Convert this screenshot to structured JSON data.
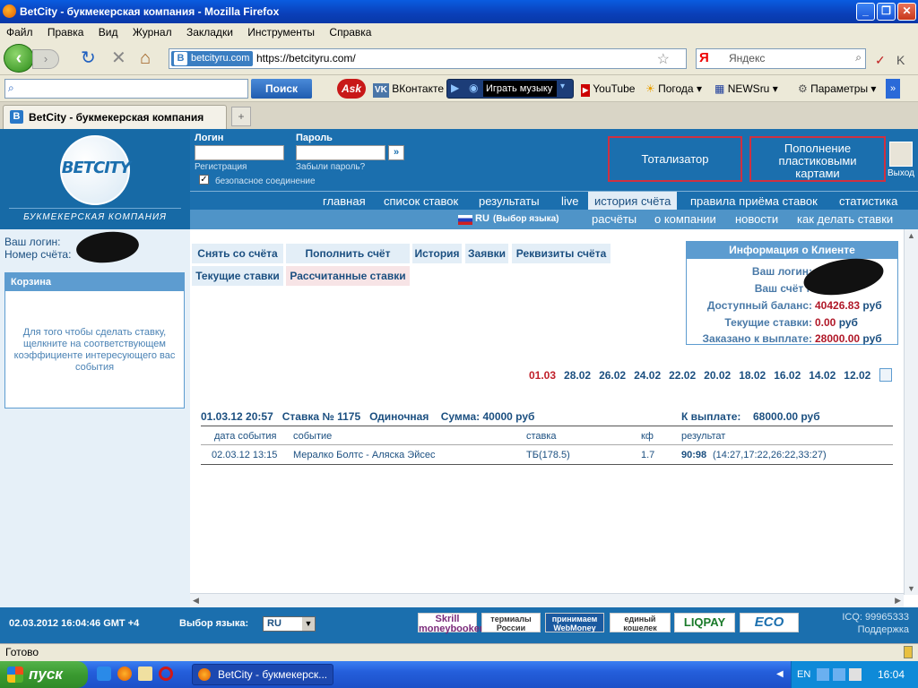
{
  "window": {
    "title": "BetCity - букмекерская компания - Mozilla Firefox"
  },
  "menu": [
    "Файл",
    "Правка",
    "Вид",
    "Журнал",
    "Закладки",
    "Инструменты",
    "Справка"
  ],
  "address": {
    "site_label": "betcityru.com",
    "url": "https://betcityru.com/"
  },
  "search": {
    "engine": "Я",
    "placeholder": "Яндекс"
  },
  "toolbar": {
    "search_button": "Поиск",
    "ask_label": "Ask",
    "vk_label": "ВКонтакте",
    "music_label": "Играть музыку",
    "youtube_label": "YouTube",
    "weather_label": "Погода",
    "news_label": "NEWSru",
    "params_label": "Параметры"
  },
  "tab": {
    "title": "BetCity - букмекерская компания"
  },
  "site": {
    "logo_text": "BETCITY",
    "logo_sub": "БУКМЕКЕРСКАЯ КОМПАНИЯ",
    "login_label": "Логин",
    "password_label": "Пароль",
    "register_link": "Регистрация",
    "forgot_link": "Забыли пароль?",
    "secure_label": "безопасное соединение",
    "totalizator": "Тотализатор",
    "topup_cards": "Пополнение пластиковыми картами",
    "exit_label": "Выход",
    "nav1": [
      "главная",
      "список ставок",
      "результаты",
      "live",
      "история счёта",
      "правила приёма ставок",
      "статистика"
    ],
    "lang_label": "RU",
    "lang_hint": "(Выбор языка)",
    "nav2": [
      "расчёты",
      "о компании",
      "новости",
      "как делать ставки"
    ]
  },
  "left": {
    "login_label": "Ваш логин:",
    "account_label": "Номер счёта:",
    "basket_title": "Корзина",
    "basket_text": "Для того чтобы сделать ставку, щелкните на соответствующем коэффициенте интересующего вас события"
  },
  "account_tabs": [
    "Снять со счёта",
    "Пополнить счёт",
    "История",
    "Заявки",
    "Реквизиты счёта",
    "Текущие ставки",
    "Рассчитанные ставки"
  ],
  "client_info": {
    "title": "Информация о Клиенте",
    "login_label": "Ваш логин:",
    "account_label": "Ваш счёт №",
    "balance_label": "Доступный баланс:",
    "balance_value": "40426.83",
    "current_bets_label": "Текущие ставки:",
    "current_bets_value": "0.00",
    "payout_label": "Заказано к выплате:",
    "payout_value": "28000.00",
    "currency": "руб"
  },
  "dates": [
    "01.03",
    "28.02",
    "26.02",
    "24.02",
    "22.02",
    "20.02",
    "18.02",
    "16.02",
    "14.02",
    "12.02",
    "»"
  ],
  "bet": {
    "datetime": "01.03.12 20:57",
    "number": "Ставка № 1175",
    "type": "Одиночная",
    "sum": "Сумма: 40000 руб",
    "payout_label": "К выплате:",
    "payout_value": "68000.00 руб",
    "headers": [
      "дата события",
      "событие",
      "ставка",
      "кф",
      "результат"
    ],
    "row": {
      "date": "02.03.12 13:15",
      "event": "Мералко Болтс - Аляска Эйсес",
      "stake": "ТБ(178.5)",
      "coef": "1.7",
      "result": "90:98",
      "result_detail": "(14:27,17:22,26:22,33:27)"
    }
  },
  "footer": {
    "datetime": "02.03.2012 16:04:46 GMT +4",
    "lang_label": "Выбор языка:",
    "lang_value": "RU",
    "icq": "ICQ: 99965333",
    "support": "Поддержка",
    "payments": [
      "Skrill moneybookers",
      "термиалы России",
      "принимаем WebMoney",
      "единый кошелек",
      "LIQPAY",
      "ECO"
    ]
  },
  "status": "Готово",
  "taskbar": {
    "start": "пуск",
    "app": "BetCity - букмекерск...",
    "lang": "EN",
    "time": "16:04"
  }
}
